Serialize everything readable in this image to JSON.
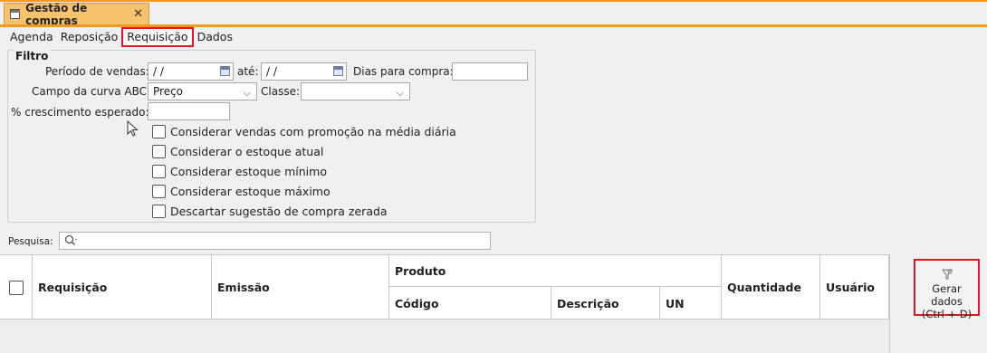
{
  "window": {
    "tab_title": "Gestão de compras",
    "close_glyph": "✕"
  },
  "tabs": [
    "Agenda",
    "Reposição",
    "Requisição",
    "Dados"
  ],
  "filter": {
    "title": "Filtro",
    "periodo_label": "Período de vendas:",
    "periodo_from": "/ /",
    "ate_label": "até:",
    "periodo_to": "/ /",
    "dias_label": "Dias para compra:",
    "dias_value": "",
    "curva_label": "Campo da curva ABC:",
    "curva_value": "Preço",
    "classe_label": "Classe:",
    "classe_value": "",
    "crescimento_label": "% crescimento esperado:",
    "crescimento_value": "",
    "checkboxes": [
      "Considerar vendas com promoção na média diária",
      "Considerar o estoque atual",
      "Considerar estoque mínimo",
      "Considerar estoque máximo",
      "Descartar sugestão de compra zerada"
    ]
  },
  "search": {
    "label": "Pesquisa:",
    "value": ""
  },
  "grid": {
    "columns": {
      "requisicao": "Requisição",
      "emissao": "Emissão",
      "produto": "Produto",
      "codigo": "Código",
      "descricao": "Descrição",
      "un": "UN",
      "quantidade": "Quantidade",
      "usuario": "Usuário"
    },
    "rows": []
  },
  "actions": {
    "gerar_dados": "Gerar dados",
    "gerar_shortcut": "(Ctrl + D)"
  },
  "colors": {
    "accent": "#f39a1e",
    "highlight": "#e0191e",
    "tab_bg": "#f6c26b"
  }
}
